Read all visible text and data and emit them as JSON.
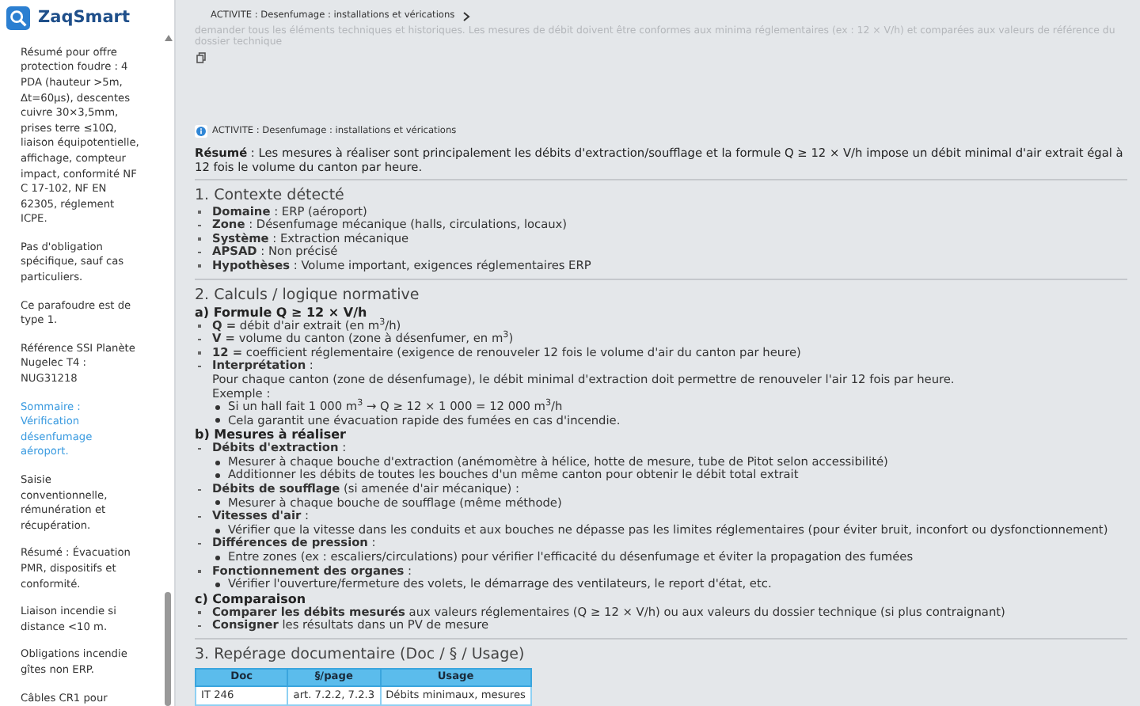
{
  "app": {
    "name": "ZaqSmart"
  },
  "sidebar": {
    "items": [
      {
        "text": "Résumé pour offre protection foudre : 4 PDA (hauteur >5m, Δt=60µs), descentes cuivre 30×3,5mm, prises terre ≤10Ω, liaison équipotentielle, affichage, compteur impact, conformité NF C 17-102, NF EN 62305, réglement ICPE.",
        "selected": false
      },
      {
        "text": "Pas d'obligation spécifique, sauf cas particuliers.",
        "selected": false
      },
      {
        "text": "Ce parafoudre est de type 1.",
        "selected": false
      },
      {
        "text": "Référence SSI Planète Nugelec T4 : NUG31218",
        "selected": false
      },
      {
        "text": "Sommaire : Vérification désenfumage aéroport.",
        "selected": true
      },
      {
        "text": "Saisie conventionnelle, rémunération et récupération.",
        "selected": false
      },
      {
        "text": "Résumé : Évacuation PMR, dispositifs et conformité.",
        "selected": false
      },
      {
        "text": "Liaison incendie si distance <10 m.",
        "selected": false
      },
      {
        "text": "Obligations incendie gîtes non ERP.",
        "selected": false
      },
      {
        "text": "Câbles CR1 pour",
        "selected": false
      }
    ]
  },
  "previous_message": {
    "breadcrumb": "ACTIVITE : Desenfumage : installations et vérications",
    "text": "demander tous les éléments techniques et historiques. Les mesures de débit doivent être conformes aux minima réglementaires (ex : 12 × V/h) et comparées aux valeurs de référence du dossier technique"
  },
  "message": {
    "breadcrumb": "ACTIVITE : Desenfumage : installations et vérications",
    "summary": "**Résumé** : Les mesures à réaliser sont principalement les débits d'extraction/soufflage et la formule Q ≥ 12 × V/h impose un débit minimal d'air extrait égal à 12 fois le volume du canton par heure.",
    "sections": [
      {
        "heading": "1. Contexte détecté",
        "blocks": [
          {
            "kind": "item",
            "text": "**Domaine** : ERP (aéroport)"
          },
          {
            "kind": "item",
            "text": "**Zone** : Désenfumage mécanique (halls, circulations, locaux)"
          },
          {
            "kind": "item",
            "text": "**Système** : Extraction mécanique"
          },
          {
            "kind": "item",
            "text": "**APSAD** : Non précisé"
          },
          {
            "kind": "item",
            "text": "**Hypothèses** : Volume important, exigences réglementaires ERP"
          }
        ]
      },
      {
        "heading": "2. Calculs / logique normative",
        "blocks": [
          {
            "kind": "subheading",
            "text": "a) Formule Q ≥ 12 × V/h"
          },
          {
            "kind": "item",
            "text": "**Q =** débit d'air extrait (en m$^{3}$/h)"
          },
          {
            "kind": "item",
            "text": "**V =** volume du canton (zone à désenfumer, en m$^{3}$)"
          },
          {
            "kind": "item",
            "text": "**12 =** coefficient réglementaire (exigence de renouveler 12 fois le volume d'air du canton par heure)"
          },
          {
            "kind": "item",
            "text": "**Interprétation** :",
            "lines": [
              "Pour chaque canton (zone de désenfumage), le débit minimal d'extraction doit permettre de renouveler l'air 12 fois par heure.",
              "Exemple :"
            ],
            "children": [
              "Si un hall fait 1 000 m$^{3}$ → Q ≥ 12 × 1 000 = 12 000 m$^{3}$/h",
              "Cela garantit une évacuation rapide des fumées en cas d'incendie."
            ]
          },
          {
            "kind": "subheading",
            "text": "b) Mesures à réaliser"
          },
          {
            "kind": "item",
            "text": "**Débits d'extraction** :",
            "children": [
              "Mesurer à chaque bouche d'extraction (anémomètre à hélice, hotte de mesure, tube de Pitot selon accessibilité)",
              "Additionner les débits de toutes les bouches d'un même canton pour obtenir le débit total extrait"
            ]
          },
          {
            "kind": "item",
            "text": "**Débits de soufflage** (si amenée d'air mécanique) :",
            "children": [
              "Mesurer à chaque bouche de soufflage (même méthode)"
            ]
          },
          {
            "kind": "item",
            "text": "**Vitesses d'air** :",
            "children": [
              "Vérifier que la vitesse dans les conduits et aux bouches ne dépasse pas les limites réglementaires (pour éviter bruit, inconfort ou dysfonctionnement)"
            ]
          },
          {
            "kind": "item",
            "text": "**Différences de pression** :",
            "children": [
              "Entre zones (ex : escaliers/circulations) pour vérifier l'efficacité du désenfumage et éviter la propagation des fumées"
            ]
          },
          {
            "kind": "item",
            "text": "**Fonctionnement des organes** :",
            "children": [
              "Vérifier l'ouverture/fermeture des volets, le démarrage des ventilateurs, le report d'état, etc."
            ]
          },
          {
            "kind": "subheading",
            "text": "c) Comparaison"
          },
          {
            "kind": "item",
            "text": "**Comparer les débits mesurés** aux valeurs réglementaires (Q ≥ 12 × V/h) ou aux valeurs du dossier technique (si plus contraignant)"
          },
          {
            "kind": "item",
            "text": "**Consigner** les résultats dans un PV de mesure"
          }
        ]
      },
      {
        "heading": "3. Repérage documentaire (Doc / § / Usage)",
        "table": {
          "columns": [
            "Doc",
            "§/page",
            "Usage"
          ],
          "rows": [
            [
              "IT 246",
              "art. 7.2.2, 7.2.3",
              "Débits minimaux, mesures"
            ]
          ]
        }
      }
    ]
  }
}
